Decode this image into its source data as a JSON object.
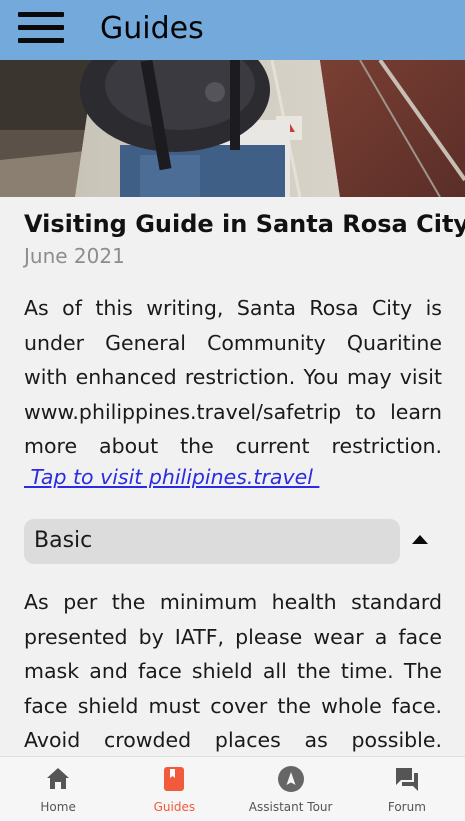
{
  "app_bar": {
    "title": "Guides",
    "menu_icon": "hamburger-menu-icon",
    "background": "#74a9dc"
  },
  "hero": {
    "image": "traveler-with-backpack-at-railway-station-photo"
  },
  "guide": {
    "title": "Visiting Guide in Santa Rosa City",
    "date": "June 2021",
    "intro": "As of this writing, Santa Rosa City is under General Community Quaritine with enhanced restriction. You may visit www.philippines.travel/safetrip to learn more about the current restriction.",
    "link_text": " Tap to visit philipines.travel ",
    "link_color": "#2b2be2"
  },
  "section": {
    "label": "Basic",
    "expanded": true,
    "caret_icon": "caret-up-icon",
    "body": "As per the minimum health standard presented by IATF, please wear a face mask and face shield all the time. The face shield must cover the whole face. Avoid crowded places as possible. However, it is"
  },
  "bottom_nav": {
    "active_color": "#f15a3a",
    "items": [
      {
        "label": "Home",
        "icon": "home-icon",
        "active": false
      },
      {
        "label": "Guides",
        "icon": "book-icon",
        "active": true
      },
      {
        "label": "Assistant Tour",
        "icon": "compass-icon",
        "active": false
      },
      {
        "label": "Forum",
        "icon": "forum-icon",
        "active": false
      }
    ]
  }
}
